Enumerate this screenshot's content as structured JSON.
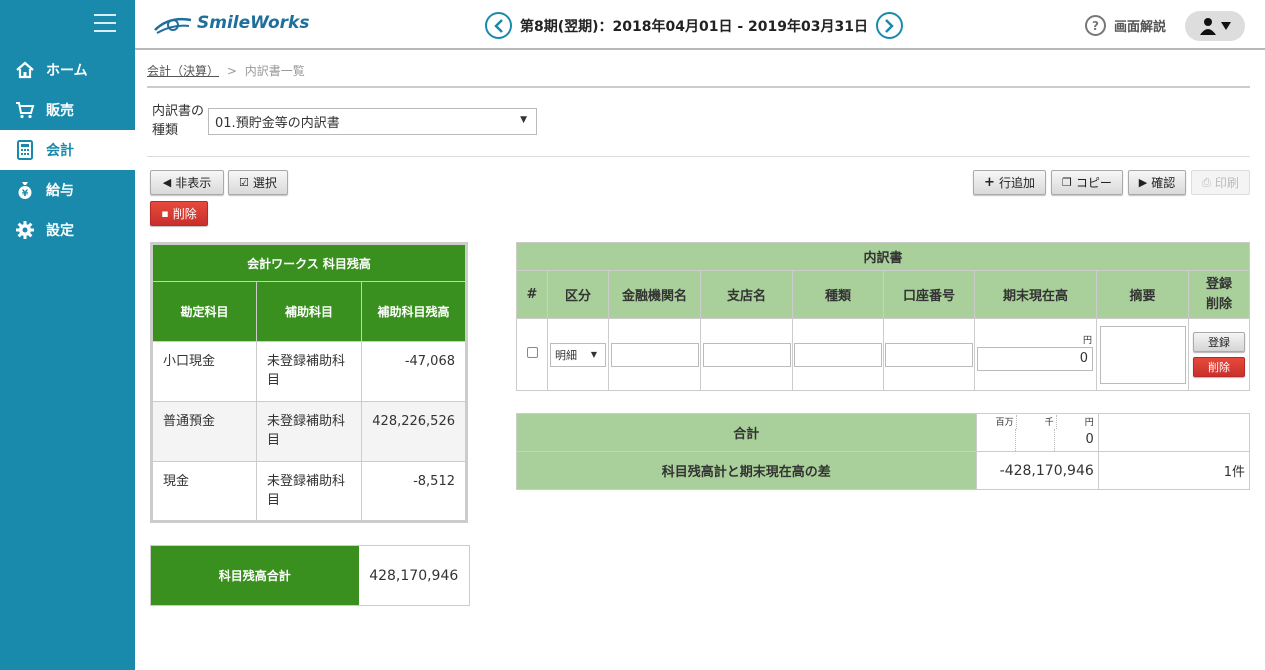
{
  "app": {
    "logo_text": "SmileWorks",
    "brand_color": "#1a8aac"
  },
  "nav": {
    "items": [
      {
        "label": "ホーム",
        "icon": "home-icon"
      },
      {
        "label": "販売",
        "icon": "cart-icon"
      },
      {
        "label": "会計",
        "icon": "calculator-icon",
        "active": true
      },
      {
        "label": "給与",
        "icon": "money-bag-icon"
      },
      {
        "label": "設定",
        "icon": "gear-icon"
      }
    ]
  },
  "header": {
    "period": "第8期(翌期)：2018年04月01日 - 2019年03月31日",
    "help_label": "画面解説"
  },
  "breadcrumb": {
    "parent": "会計（決算）",
    "sep": ">",
    "current": "内訳書一覧"
  },
  "form": {
    "type_label_line1": "内訳書の",
    "type_label_line2": "種類",
    "type_value": "01.預貯金等の内訳書"
  },
  "toolbar": {
    "hide": "非表示",
    "select": "選択",
    "delete": "削除",
    "add_row": "行追加",
    "copy": "コピー",
    "confirm": "確認",
    "print": "印刷"
  },
  "left_table": {
    "title": "会計ワークス 科目残高",
    "headers": [
      "勘定科目",
      "補助科目",
      "補助科目残高"
    ],
    "rows": [
      [
        "小口現金",
        "未登録補助科目",
        "-47,068"
      ],
      [
        "普通預金",
        "未登録補助科目",
        "428,226,526"
      ],
      [
        "現金",
        "未登録補助科目",
        "-8,512"
      ]
    ]
  },
  "summary": {
    "label": "科目残高合計",
    "value": "428,170,946"
  },
  "right_table": {
    "title": "内訳書",
    "headers": [
      "#",
      "区分",
      "金融機関名",
      "支店名",
      "種類",
      "口座番号",
      "期末現在高",
      "摘要"
    ],
    "header_last_line1": "登録",
    "header_last_line2": "削除",
    "row": {
      "kubun": "明細",
      "unit": "円",
      "amount": "0",
      "register": "登録",
      "delete": "削除"
    }
  },
  "totals": {
    "total_label": "合計",
    "units": [
      "百万",
      "千",
      "円"
    ],
    "total_value": "0",
    "diff_label": "科目残高計と期末現在高の差",
    "diff_value": "-428,170,946",
    "count": "1件"
  }
}
